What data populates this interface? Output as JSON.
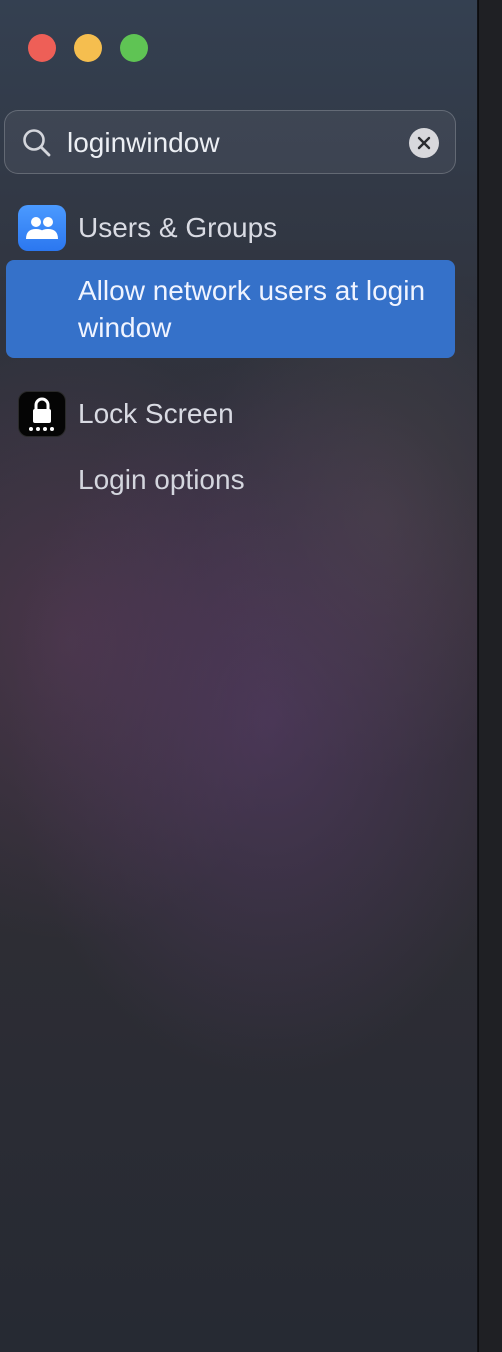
{
  "window": {
    "controls": [
      {
        "name": "close",
        "color": "#ee5f57"
      },
      {
        "name": "minimize",
        "color": "#f5be4f"
      },
      {
        "name": "zoom",
        "color": "#5fc454"
      }
    ]
  },
  "search": {
    "value": "loginwindow",
    "icon": "magnifying-glass-icon",
    "clear_icon": "clear-x-icon"
  },
  "results": [
    {
      "app": "Users & Groups",
      "icon": "users-groups-icon",
      "icon_color": "#3b8bff",
      "items": [
        {
          "label": "Allow network users at login window",
          "selected": true
        }
      ]
    },
    {
      "app": "Lock Screen",
      "icon": "lock-screen-icon",
      "icon_color": "#050505",
      "items": [
        {
          "label": "Login options",
          "selected": false
        }
      ]
    }
  ],
  "accent_color": "#3571c9"
}
